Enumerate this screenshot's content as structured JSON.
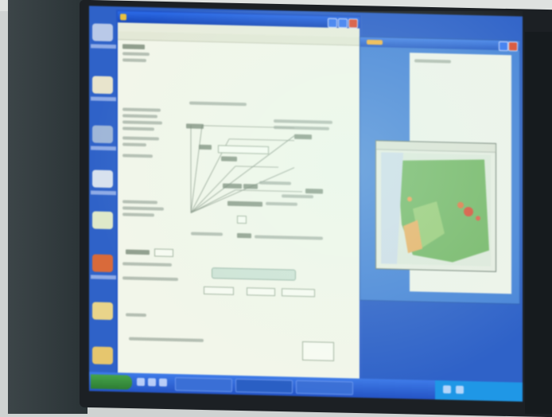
{
  "window": {
    "title": "",
    "menu": [
      "",
      "",
      "",
      "",
      "",
      "",
      "",
      "",
      "",
      ""
    ]
  },
  "taskbar": {
    "start_label": "",
    "tasks": [
      "",
      "",
      ""
    ],
    "clock": ""
  },
  "colors": {
    "desktop": "#2f62c8",
    "titlebar": "#2256c8",
    "document": "#f2f6ea",
    "start_button": "#3c9a41",
    "map_green": "#6fb35e",
    "map_orange": "#e8a055",
    "map_red": "#d8543c"
  },
  "icons": {
    "desktop": [
      "my-computer-icon",
      "documents-icon",
      "network-icon",
      "recycle-bin-icon",
      "app-icon",
      "folder-icon",
      "drive-icon"
    ],
    "tray": [
      "speaker-icon",
      "network-status-icon"
    ]
  }
}
